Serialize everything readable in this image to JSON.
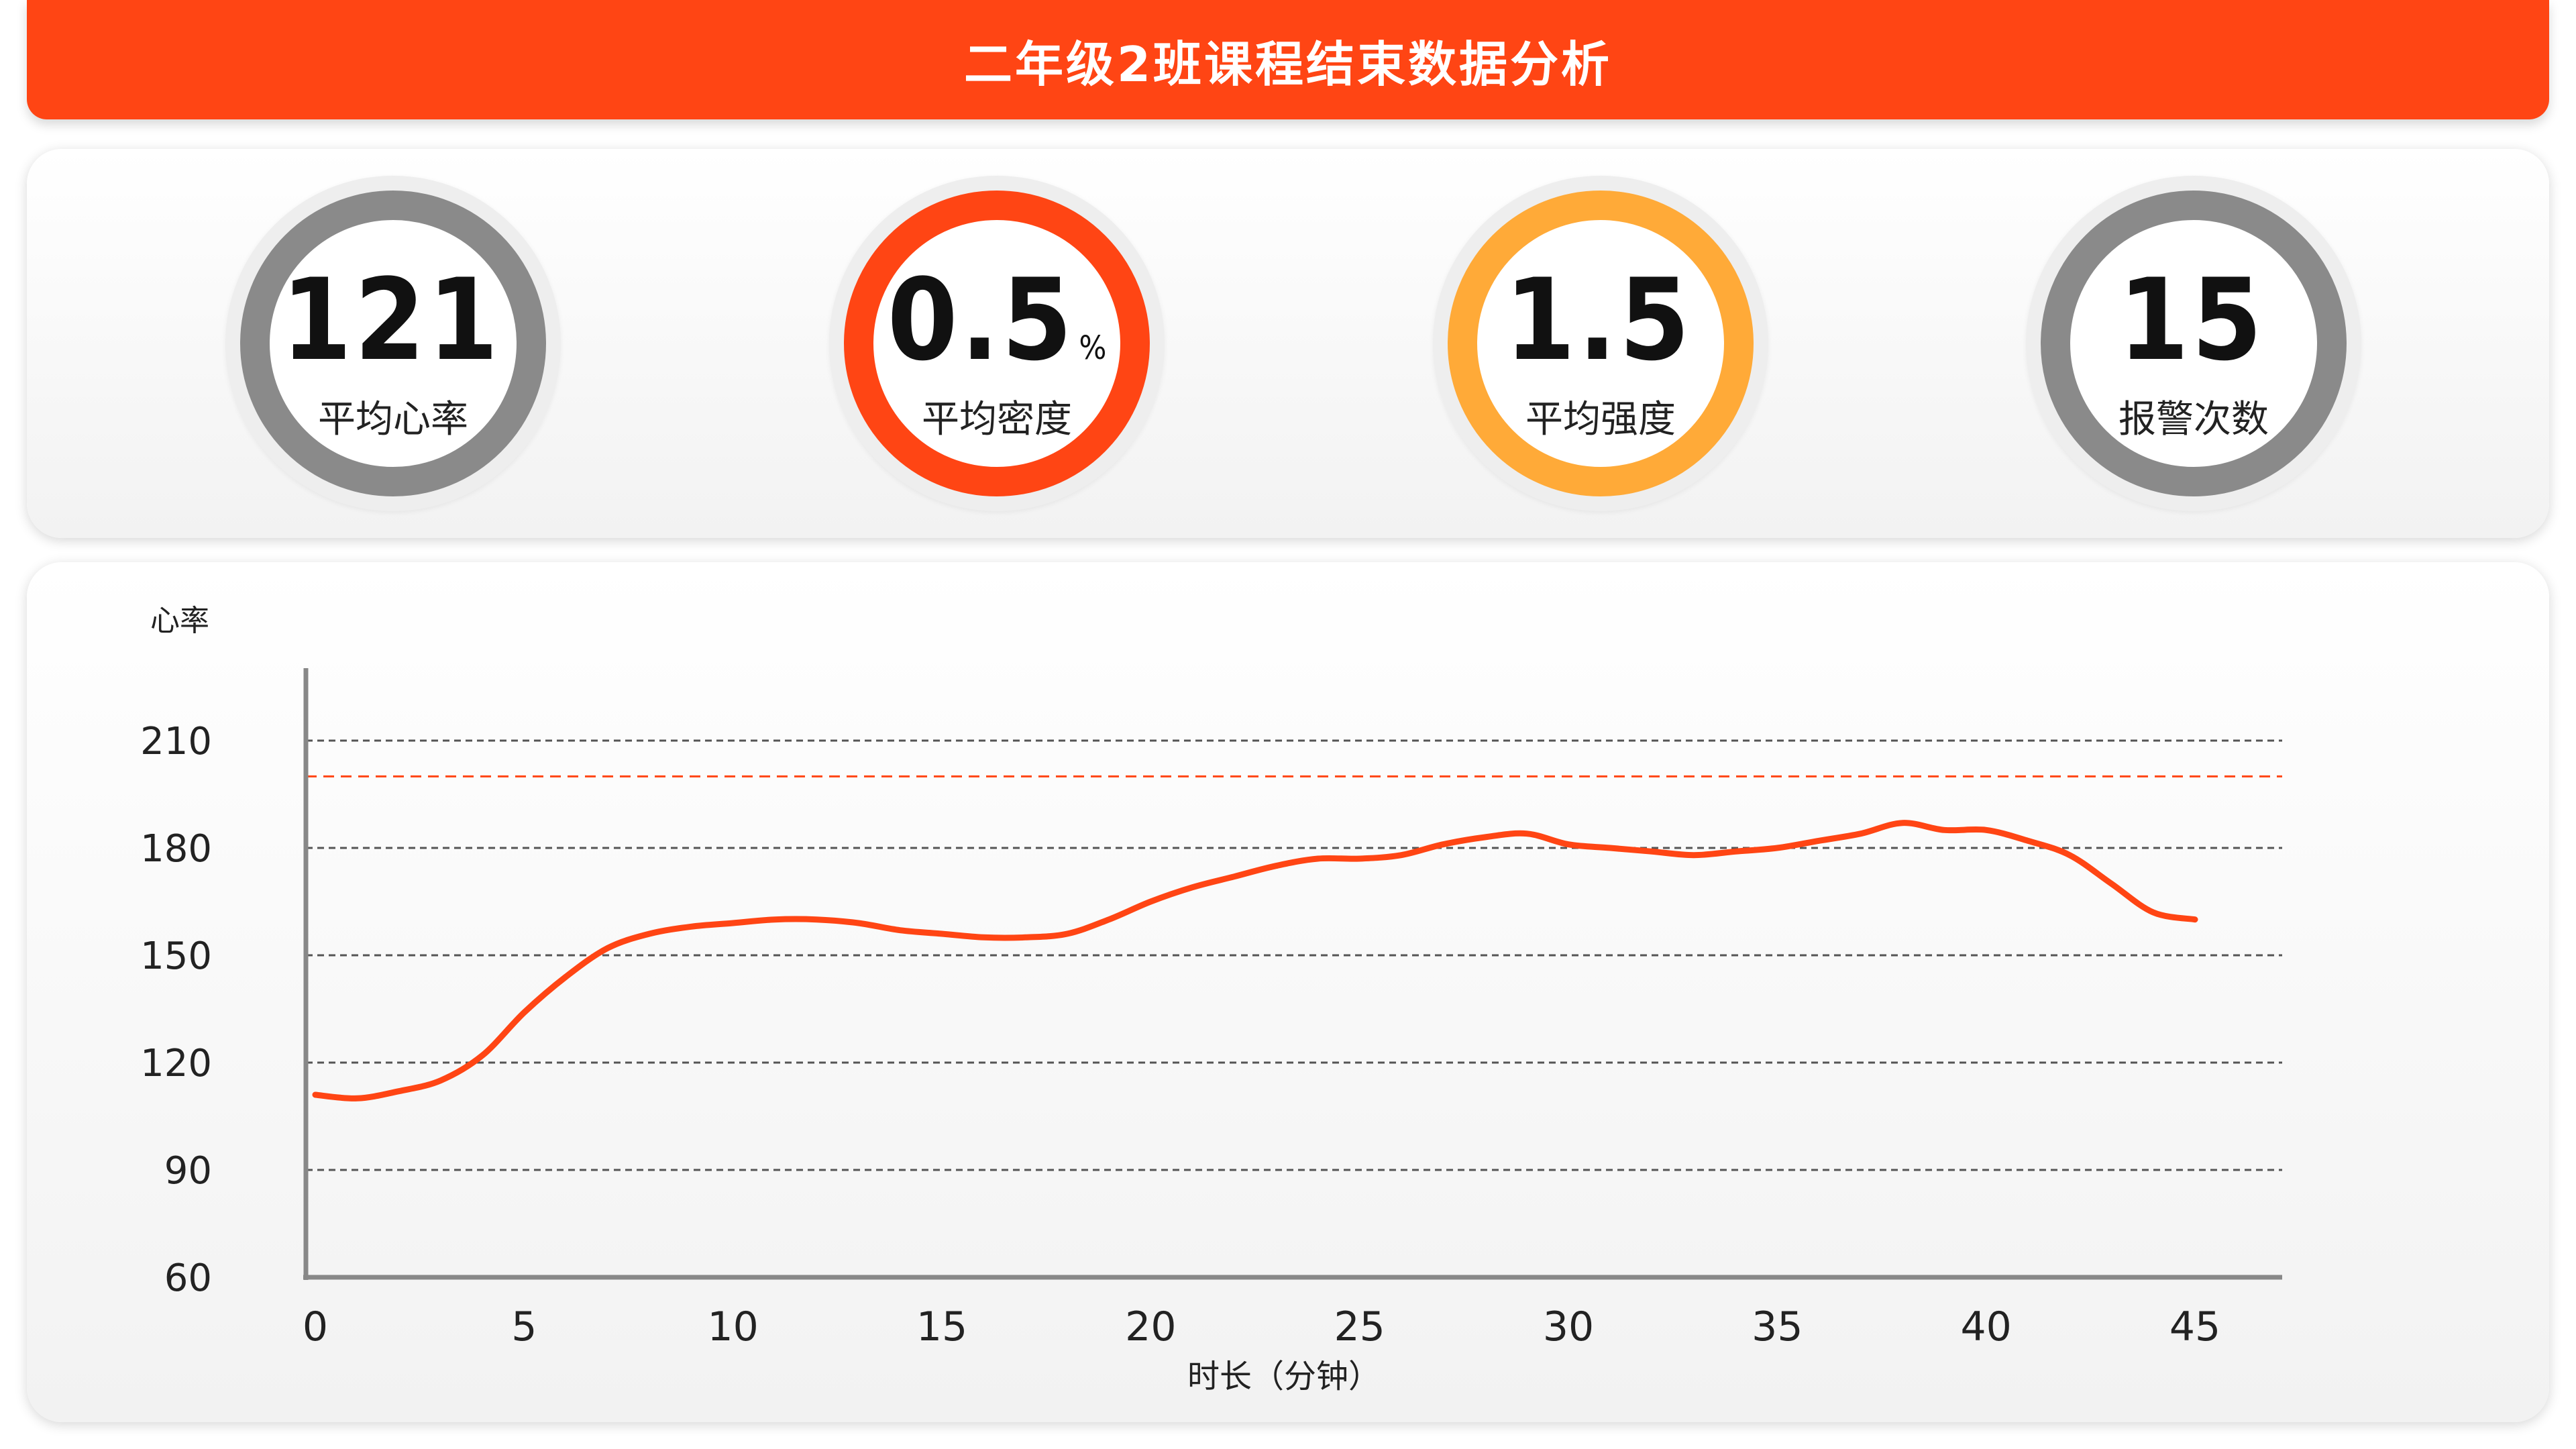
{
  "header": {
    "title": "二年级2班课程结束数据分析"
  },
  "stats": [
    {
      "value": "121",
      "unit": "",
      "label": "平均心率",
      "color": "#8a8a8a"
    },
    {
      "value": "0.5",
      "unit": "%",
      "label": "平均密度",
      "color": "#ff4514"
    },
    {
      "value": "1.5",
      "unit": "",
      "label": "平均强度",
      "color": "#ffaa38"
    },
    {
      "value": "15",
      "unit": "",
      "label": "报警次数",
      "color": "#8a8a8a"
    }
  ],
  "chart_data": {
    "type": "line",
    "xlabel": "时长（分钟）",
    "ylabel": "心率",
    "xlim": [
      0,
      45
    ],
    "ylim": [
      60,
      220
    ],
    "xticks": [
      0,
      5,
      10,
      15,
      20,
      25,
      30,
      35,
      40,
      45
    ],
    "yticks": [
      60,
      90,
      120,
      150,
      180,
      210
    ],
    "grid": true,
    "threshold": 200,
    "series": [
      {
        "color": "#ff4514",
        "x": [
          0,
          1,
          2,
          3,
          4,
          5,
          6,
          7,
          8,
          9,
          10,
          11,
          12,
          13,
          14,
          15,
          16,
          17,
          18,
          19,
          20,
          21,
          22,
          23,
          24,
          25,
          26,
          27,
          28,
          29,
          30,
          31,
          32,
          33,
          34,
          35,
          36,
          37,
          38,
          39,
          40,
          41,
          42,
          43,
          44,
          45
        ],
        "y": [
          111,
          110,
          112,
          115,
          122,
          134,
          144,
          152,
          156,
          158,
          159,
          160,
          160,
          159,
          157,
          156,
          155,
          155,
          156,
          160,
          165,
          169,
          172,
          175,
          177,
          177,
          178,
          181,
          183,
          184,
          181,
          180,
          179,
          178,
          179,
          180,
          182,
          184,
          187,
          185,
          185,
          182,
          178,
          170,
          162,
          160
        ]
      }
    ]
  }
}
